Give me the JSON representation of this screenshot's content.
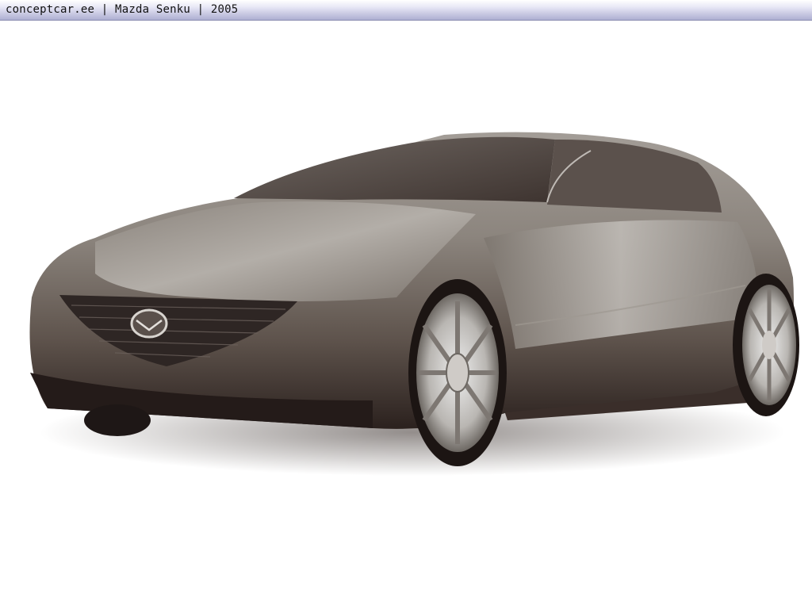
{
  "header": {
    "title": "conceptcar.ee | Mazda Senku | 2005"
  },
  "image": {
    "subject_icon": "concept-car-photo",
    "colors": {
      "background": "#ffffff",
      "body": "#8f8880",
      "body_dark": "#3a2e2a",
      "header_band": "#c8c8e2"
    }
  }
}
